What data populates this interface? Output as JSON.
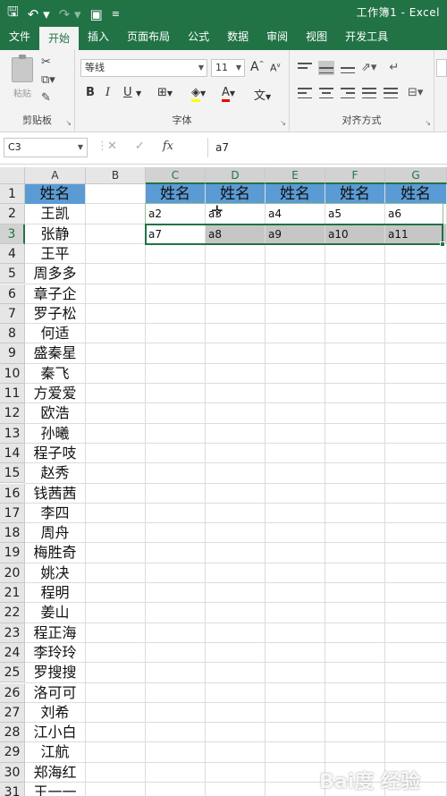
{
  "title": "工作簿1 - Excel",
  "tabs": [
    "文件",
    "开始",
    "插入",
    "页面布局",
    "公式",
    "数据",
    "审阅",
    "视图",
    "开发工具"
  ],
  "active_tab": "开始",
  "ribbon": {
    "clipboard_label": "剪贴板",
    "paste_label": "粘贴",
    "font_label": "字体",
    "align_label": "对齐方式",
    "font_name": "等线",
    "font_size": "11",
    "grow_font": "A",
    "shrink_font": "A",
    "bold": "B",
    "italic": "I",
    "underline": "U",
    "font_color_letter": "A",
    "wen": "文"
  },
  "formula_bar": {
    "name_box": "C3",
    "fx": "fx",
    "formula": "a7"
  },
  "columns": [
    "A",
    "B",
    "C",
    "D",
    "E",
    "F",
    "G"
  ],
  "rows": [
    "1",
    "2",
    "3",
    "4",
    "5",
    "6",
    "7",
    "8",
    "9",
    "10",
    "11",
    "12",
    "13",
    "14",
    "15",
    "16",
    "17",
    "18",
    "19",
    "20",
    "21",
    "22",
    "23",
    "24",
    "25",
    "26",
    "27",
    "28",
    "29",
    "30",
    "31"
  ],
  "names": [
    "姓名",
    "王凯",
    "张静",
    "王平",
    "周多多",
    "章子企",
    "罗子松",
    "何适",
    "盛秦星",
    "秦飞",
    "方爱爱",
    "欧浩",
    "孙曦",
    "程子吱",
    "赵秀",
    "钱茜茜",
    "李四",
    "周舟",
    "梅胜奇",
    "姚决",
    "程明",
    "姜山",
    "程正海",
    "李玲玲",
    "罗搜搜",
    "洛可可",
    "刘希",
    "江小白",
    "江航",
    "郑海红",
    "王一一"
  ],
  "header_row": [
    "姓名",
    "姓名",
    "姓名",
    "姓名",
    "姓名"
  ],
  "row2_values": [
    "a2",
    "a3",
    "a4",
    "a5",
    "a6"
  ],
  "row3_values": [
    "a7",
    "a8",
    "a9",
    "a10",
    "a11"
  ],
  "watermark": "Bai度 经验"
}
